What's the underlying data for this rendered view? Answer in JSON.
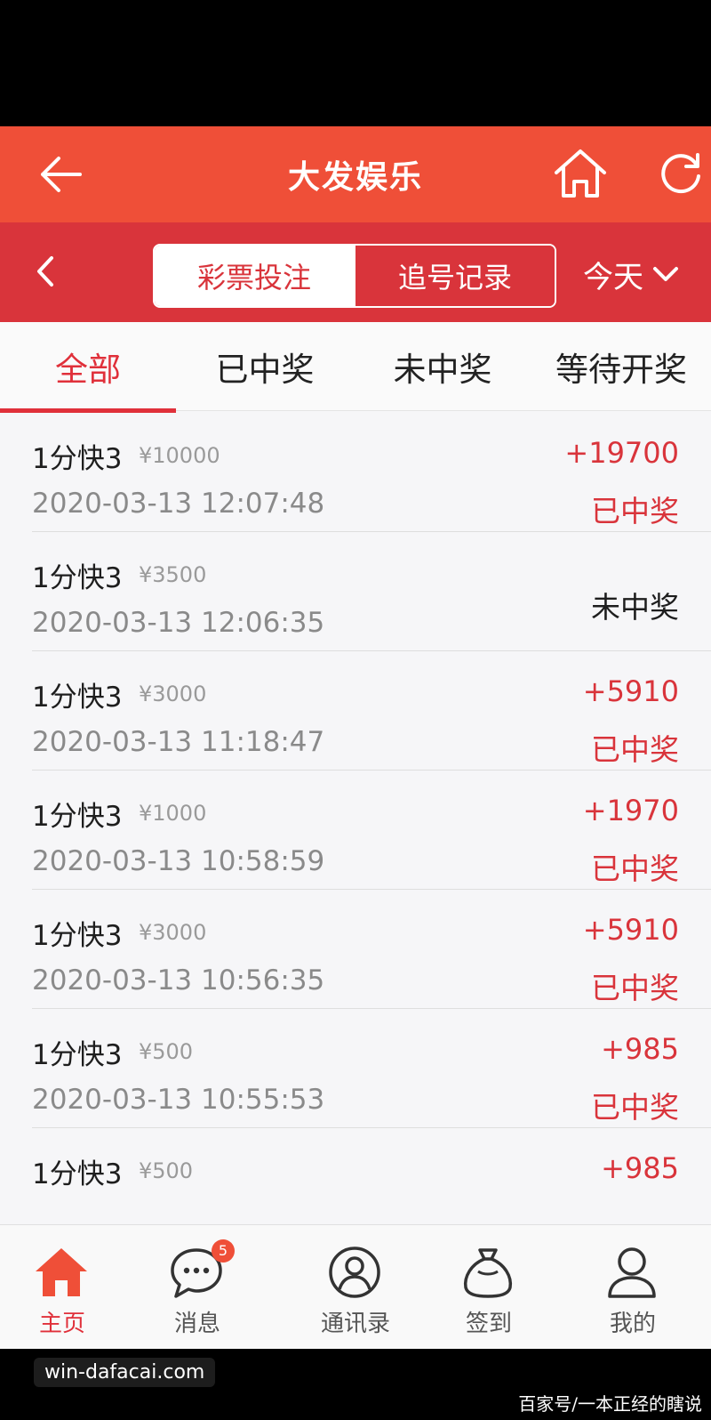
{
  "header": {
    "title": "大发娱乐",
    "back_icon": "arrow-left-icon",
    "home_icon": "home-icon",
    "refresh_icon": "refresh-icon"
  },
  "segment": {
    "options": [
      "彩票投注",
      "追号记录"
    ],
    "selected": "彩票投注",
    "date_filter": "今天"
  },
  "tabs": [
    "全部",
    "已中奖",
    "未中奖",
    "等待开奖"
  ],
  "active_tab": "全部",
  "records": [
    {
      "name": "1分快3",
      "amount": "¥10000",
      "time": "2020-03-13 12:07:48",
      "payout": "+19700",
      "status": "已中奖"
    },
    {
      "name": "1分快3",
      "amount": "¥3500",
      "time": "2020-03-13 12:06:35",
      "payout": "",
      "status": "未中奖"
    },
    {
      "name": "1分快3",
      "amount": "¥3000",
      "time": "2020-03-13 11:18:47",
      "payout": "+5910",
      "status": "已中奖"
    },
    {
      "name": "1分快3",
      "amount": "¥1000",
      "time": "2020-03-13 10:58:59",
      "payout": "+1970",
      "status": "已中奖"
    },
    {
      "name": "1分快3",
      "amount": "¥3000",
      "time": "2020-03-13 10:56:35",
      "payout": "+5910",
      "status": "已中奖"
    },
    {
      "name": "1分快3",
      "amount": "¥500",
      "time": "2020-03-13 10:55:53",
      "payout": "+985",
      "status": "已中奖"
    },
    {
      "name": "1分快3",
      "amount": "¥500",
      "time": "",
      "payout": "+985",
      "status": ""
    }
  ],
  "bottom_nav": [
    {
      "label": "主页",
      "icon": "home-filled-icon"
    },
    {
      "label": "消息",
      "icon": "message-bubble-icon",
      "badge": "5"
    },
    {
      "label": "通讯录",
      "icon": "contacts-icon"
    },
    {
      "label": "签到",
      "icon": "money-bag-icon"
    },
    {
      "label": "我的",
      "icon": "profile-icon"
    }
  ],
  "watermarks": {
    "left": "win-dafacai.com",
    "right": "百家号/一本正经的瞎说"
  },
  "colors": {
    "header_red": "#ef4f38",
    "segment_red": "#d9343b",
    "accent_red": "#e0303a"
  }
}
